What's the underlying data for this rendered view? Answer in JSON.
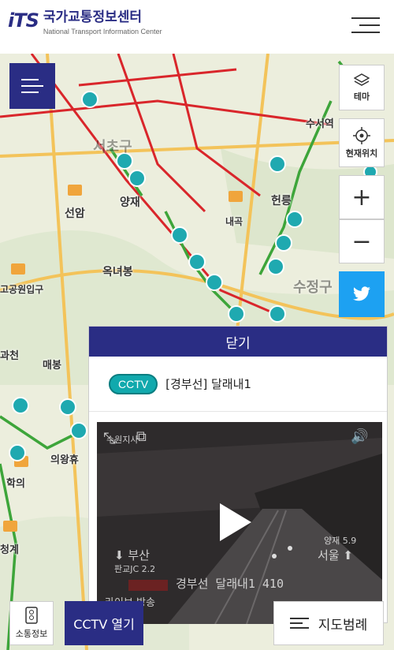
{
  "header": {
    "logo_mark": "iTS",
    "logo_kor": "국가교통정보센터",
    "logo_eng": "National Transport Information Center"
  },
  "map": {
    "labels": [
      "서초구",
      "양재",
      "선암",
      "내곡",
      "헌릉",
      "수서역",
      "옥녀봉",
      "수정구",
      "고공원입구",
      "매봉",
      "의왕휴",
      "학의",
      "청계",
      "과천"
    ],
    "ic_badge": "IC"
  },
  "side_buttons": {
    "theme": "테마",
    "location": "현재위치",
    "zoom_in": "+",
    "zoom_out": "−"
  },
  "panel": {
    "close_label": "닫기",
    "badge": "CCTV",
    "title": "[경부선] 달래내1",
    "video": {
      "caption_left": "부산",
      "caption_left_sub": "판교JC 2.2",
      "caption_right": "서울",
      "caption_right_sub": "양재 5.9",
      "caption_bottom": "경부선 달래내1 410",
      "live_label": "라이브 방송",
      "watermark": "수원지사"
    }
  },
  "bottom_bar": {
    "traffic_info": "소통정보",
    "cctv_open": "CCTV 열기",
    "legend": "지도범례"
  },
  "colors": {
    "brand": "#2a2d84",
    "cctv": "#11a9ad",
    "twitter": "#1da1f2"
  }
}
